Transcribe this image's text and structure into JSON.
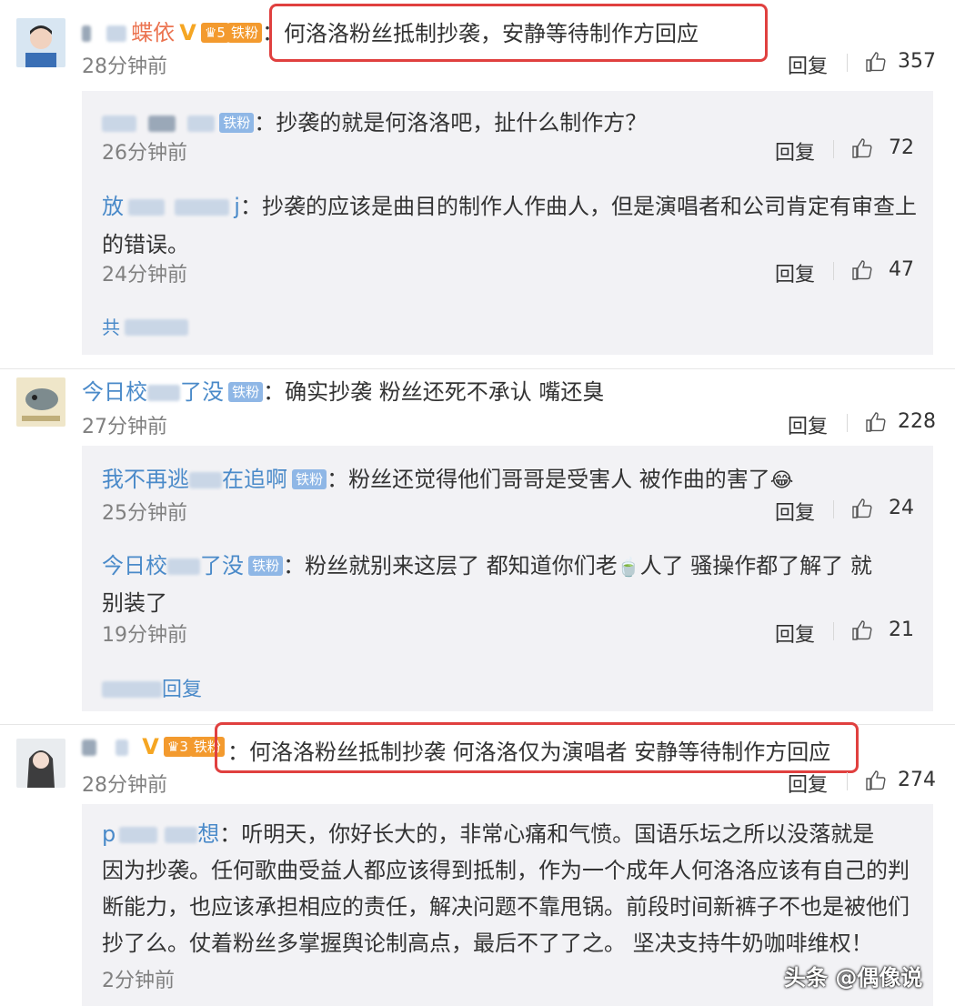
{
  "comments": [
    {
      "user": "蝶依",
      "badge": "铁粉",
      "level": "5",
      "text": "何洛洛粉丝抵制抄袭，安静等待制作方回应",
      "time": "28分钟前",
      "reply_label": "回复",
      "likes": "357",
      "replies": [
        {
          "user_suffix": "",
          "badge": "铁粉",
          "text": "：抄袭的就是何洛洛吧，扯什么制作方？",
          "time": "26分钟前",
          "reply_label": "回复",
          "likes": "72"
        },
        {
          "user_prefix": "放",
          "user_suffix": "j",
          "text_line1": "：抄袭的应该是曲目的制作人作曲人，但是演唱者和公司肯定有审查上",
          "text_line2": "的错误。",
          "time": "24分钟前",
          "reply_label": "回复",
          "likes": "47"
        }
      ],
      "more_label": "共"
    },
    {
      "user_prefix": "今日校",
      "user_suffix": "了没",
      "badge": "铁粉",
      "text": "：确实抄袭  粉丝还死不承认  嘴还臭",
      "time": "27分钟前",
      "reply_label": "回复",
      "likes": "228",
      "replies": [
        {
          "user_prefix": "我不再逃",
          "user_suffix": "在追啊",
          "badge": "铁粉",
          "text": "：粉丝还觉得他们哥哥是受害人  被作曲的害了",
          "time": "25分钟前",
          "reply_label": "回复",
          "likes": "24"
        },
        {
          "user_prefix": "今日校",
          "user_suffix": "了没",
          "badge": "铁粉",
          "text_line1a": "：粉丝就别来这层了  都知道你们老",
          "text_line1b": "人了  骚操作都了解了  就",
          "text_line2": "别装了",
          "time": "19分钟前",
          "reply_label": "回复",
          "likes": "21"
        }
      ],
      "more_label": "回复"
    },
    {
      "badge": "铁粉",
      "level": "3",
      "text": "：何洛洛粉丝抵制抄袭  何洛洛仅为演唱者  安静等待制作方回应",
      "time": "28分钟前",
      "reply_label": "回复",
      "likes": "274",
      "replies": [
        {
          "user_prefix": "p",
          "user_suffix": "想",
          "lines": [
            "：听明天，你好长大的，非常心痛和气愤。国语乐坛之所以没落就是",
            "因为抄袭。任何歌曲受益人都应该得到抵制，作为一个成年人何洛洛应该有自己的判",
            "断能力，也应该承担相应的责任，解决问题不靠甩锅。前段时间新裤子不也是被他们",
            "抄了么。仗着粉丝多掌握舆论制高点，最后不了了之。  坚决支持牛奶咖啡维权！"
          ],
          "time": "2分钟前"
        }
      ]
    }
  ],
  "watermark": "头条 @偶像说",
  "icons": {
    "like": "thumbs-up-icon",
    "verified": "v-icon",
    "crown": "crown-icon"
  },
  "colors": {
    "username": "#eb7350",
    "link": "#4a8ac9",
    "highlight": "#e0403f"
  }
}
